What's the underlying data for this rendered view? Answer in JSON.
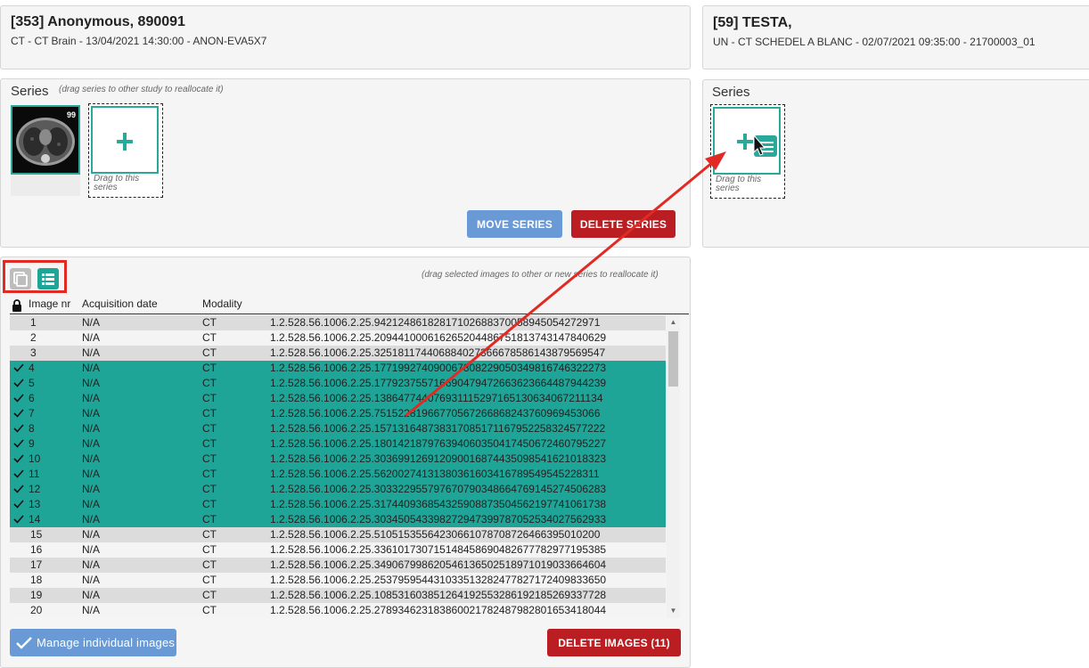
{
  "source_study": {
    "title": "[353] Anonymous, 890091",
    "subtitle": "CT - CT Brain - 13/04/2021 14:30:00 - ANON-EVA5X7",
    "series_heading": "Series",
    "series_hint": "(drag series to other study to reallocate it)",
    "thumbnail_count": "99",
    "drop_label": "Drag to this series",
    "move_button": "MOVE SERIES",
    "delete_button": "DELETE SERIES"
  },
  "target_study": {
    "title": "[59] TESTA,",
    "subtitle": "UN - CT SCHEDEL A BLANC - 02/07/2021 09:35:00 - 21700003_01",
    "series_heading": "Series",
    "drop_label": "Drag to this series"
  },
  "images_panel": {
    "hint": "(drag selected images to other or new series to reallocate it)",
    "columns": [
      "Image nr",
      "Acquisition date",
      "Modality",
      ""
    ],
    "manage_button": "Manage individual images",
    "delete_button": "DELETE IMAGES (11)",
    "rows": [
      {
        "nr": "1",
        "date": "N/A",
        "modality": "CT",
        "uid": "1.2.528.56.1006.2.25.94212486182817102688370058945054272971",
        "selected": false
      },
      {
        "nr": "2",
        "date": "N/A",
        "modality": "CT",
        "uid": "1.2.528.56.1006.2.25.209441000616265204486751813743147840629",
        "selected": false
      },
      {
        "nr": "3",
        "date": "N/A",
        "modality": "CT",
        "uid": "1.2.528.56.1006.2.25.325181174406884027366678586143879569547",
        "selected": false
      },
      {
        "nr": "4",
        "date": "N/A",
        "modality": "CT",
        "uid": "1.2.528.56.1006.2.25.177199274090067808229050349816746322273",
        "selected": true
      },
      {
        "nr": "5",
        "date": "N/A",
        "modality": "CT",
        "uid": "1.2.528.56.1006.2.25.177923755716690479472663623664487944239",
        "selected": true
      },
      {
        "nr": "6",
        "date": "N/A",
        "modality": "CT",
        "uid": "1.2.528.56.1006.2.25.138647744076931115297165130634067211134",
        "selected": true
      },
      {
        "nr": "7",
        "date": "N/A",
        "modality": "CT",
        "uid": "1.2.528.56.1006.2.25.75152281966770567266868243760969453066",
        "selected": true
      },
      {
        "nr": "8",
        "date": "N/A",
        "modality": "CT",
        "uid": "1.2.528.56.1006.2.25.157131648738317085171167952258324577222",
        "selected": true
      },
      {
        "nr": "9",
        "date": "N/A",
        "modality": "CT",
        "uid": "1.2.528.56.1006.2.25.180142187976394060350417450672460795227",
        "selected": true
      },
      {
        "nr": "10",
        "date": "N/A",
        "modality": "CT",
        "uid": "1.2.528.56.1006.2.25.303699126912090016874435098541621018323",
        "selected": true
      },
      {
        "nr": "11",
        "date": "N/A",
        "modality": "CT",
        "uid": "1.2.528.56.1006.2.25.56200274131380361603416789549545228311",
        "selected": true
      },
      {
        "nr": "12",
        "date": "N/A",
        "modality": "CT",
        "uid": "1.2.528.56.1006.2.25.303322955797670790348664769145274506283",
        "selected": true
      },
      {
        "nr": "13",
        "date": "N/A",
        "modality": "CT",
        "uid": "1.2.528.56.1006.2.25.317440936854325908873504562197741061738",
        "selected": true
      },
      {
        "nr": "14",
        "date": "N/A",
        "modality": "CT",
        "uid": "1.2.528.56.1006.2.25.303450543398272947399787052534027562933",
        "selected": true
      },
      {
        "nr": "15",
        "date": "N/A",
        "modality": "CT",
        "uid": "1.2.528.56.1006.2.25.51051535564230661078708726466395010200",
        "selected": false
      },
      {
        "nr": "16",
        "date": "N/A",
        "modality": "CT",
        "uid": "1.2.528.56.1006.2.25.336101730715148458690482677782977195385",
        "selected": false
      },
      {
        "nr": "17",
        "date": "N/A",
        "modality": "CT",
        "uid": "1.2.528.56.1006.2.25.349067998620546136502518971019033664604",
        "selected": false
      },
      {
        "nr": "18",
        "date": "N/A",
        "modality": "CT",
        "uid": "1.2.528.56.1006.2.25.253795954431033513282477827172409833650",
        "selected": false
      },
      {
        "nr": "19",
        "date": "N/A",
        "modality": "CT",
        "uid": "1.2.528.56.1006.2.25.108531603851264192553286192185269337728",
        "selected": false
      },
      {
        "nr": "20",
        "date": "N/A",
        "modality": "CT",
        "uid": "1.2.528.56.1006.2.25.278934623183860021782487982801653418044",
        "selected": false
      }
    ]
  },
  "icons": {
    "lock": "lock-icon",
    "thumbnail_view": "thumbnail-view-icon",
    "list_view": "list-view-icon",
    "check": "check-icon",
    "plus": "plus-icon"
  },
  "colors": {
    "accent": "#1fa597",
    "danger": "#bb1e22",
    "primary": "#6a9ad6",
    "annotation": "#e22a24"
  }
}
